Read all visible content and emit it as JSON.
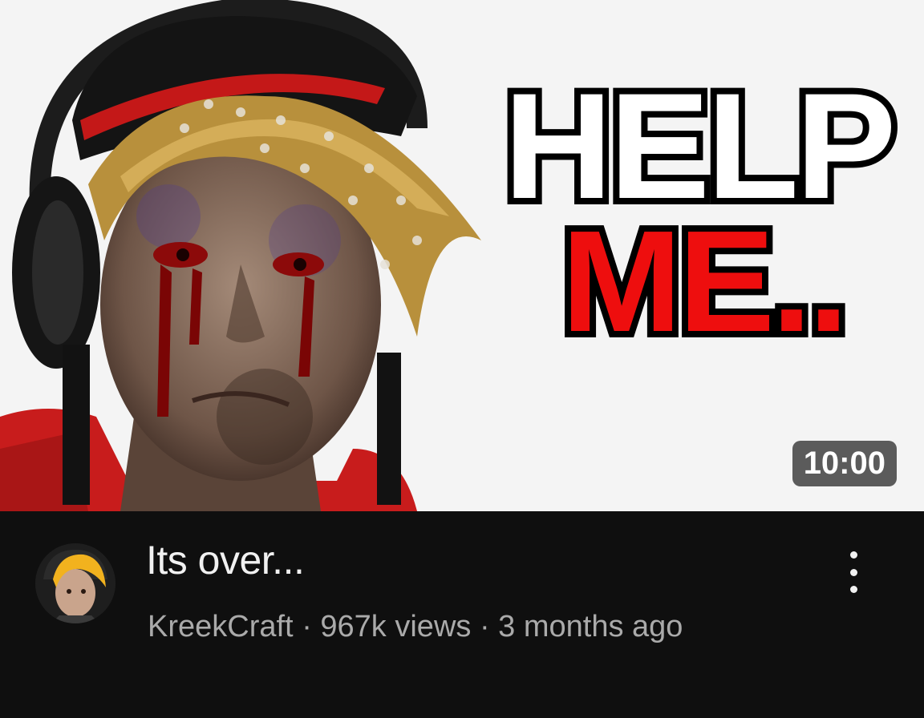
{
  "video": {
    "thumbnail": {
      "overlay_line1": "HELP",
      "overlay_line2": "ME..",
      "duration": "10:00"
    },
    "title": "Its over...",
    "channel": "KreekCraft",
    "separator": "·",
    "views": "967k views",
    "age": "3 months ago"
  },
  "icons": {
    "menu": "more-vert-icon",
    "avatar": "channel-avatar"
  },
  "colors": {
    "overlay_red": "#ee0e0e",
    "background_dark": "#0f0f0f",
    "meta_text": "#aaaaaa",
    "title_text": "#f1f1f1"
  }
}
